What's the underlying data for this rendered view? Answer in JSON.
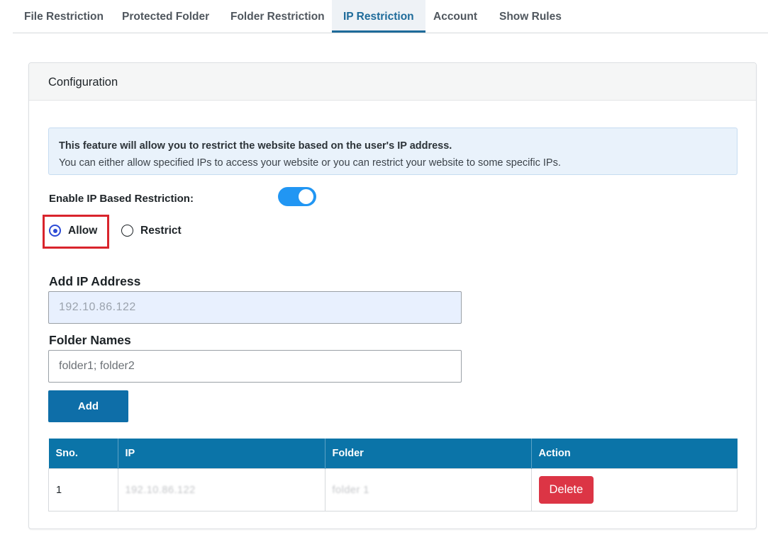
{
  "tabs": [
    {
      "label": "File Restriction"
    },
    {
      "label": "Protected Folder"
    },
    {
      "label": "Folder Restriction"
    },
    {
      "label": "IP Restriction"
    },
    {
      "label": "Account"
    },
    {
      "label": "Show Rules"
    }
  ],
  "active_tab": "IP Restriction",
  "card": {
    "title": "Configuration",
    "notice_bold": "This feature will allow you to restrict the website based on the user's IP address.",
    "notice_text": "You can either allow specified IPs to access your website or you can restrict your website to some specific IPs."
  },
  "toggle": {
    "label": "Enable IP Based Restriction:",
    "enabled": true
  },
  "mode": {
    "options": [
      "Allow",
      "Restrict"
    ],
    "selected": "Allow"
  },
  "form": {
    "ip_label": "Add IP Address",
    "ip_value": "192.10.86.122",
    "folder_label": "Folder Names",
    "folder_placeholder": "folder1; folder2",
    "add_label": "Add"
  },
  "table": {
    "headers": [
      "Sno.",
      "IP",
      "Folder",
      "Action"
    ],
    "rows": [
      {
        "sno": "1",
        "ip": "192.10.86.122",
        "folder": "folder 1",
        "action": "Delete"
      }
    ]
  },
  "colors": {
    "accent": "#0b74a8",
    "toggle": "#2196f3",
    "danger": "#dc3545",
    "highlight": "#d9242c"
  }
}
